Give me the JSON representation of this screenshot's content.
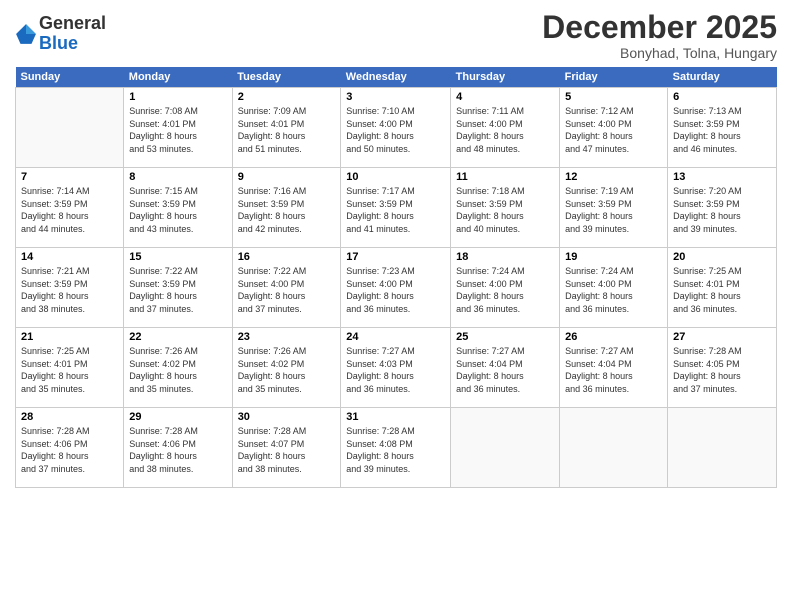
{
  "logo": {
    "general": "General",
    "blue": "Blue"
  },
  "title": "December 2025",
  "location": "Bonyhad, Tolna, Hungary",
  "days_of_week": [
    "Sunday",
    "Monday",
    "Tuesday",
    "Wednesday",
    "Thursday",
    "Friday",
    "Saturday"
  ],
  "weeks": [
    [
      {
        "day": "",
        "info": ""
      },
      {
        "day": "1",
        "info": "Sunrise: 7:08 AM\nSunset: 4:01 PM\nDaylight: 8 hours\nand 53 minutes."
      },
      {
        "day": "2",
        "info": "Sunrise: 7:09 AM\nSunset: 4:01 PM\nDaylight: 8 hours\nand 51 minutes."
      },
      {
        "day": "3",
        "info": "Sunrise: 7:10 AM\nSunset: 4:00 PM\nDaylight: 8 hours\nand 50 minutes."
      },
      {
        "day": "4",
        "info": "Sunrise: 7:11 AM\nSunset: 4:00 PM\nDaylight: 8 hours\nand 48 minutes."
      },
      {
        "day": "5",
        "info": "Sunrise: 7:12 AM\nSunset: 4:00 PM\nDaylight: 8 hours\nand 47 minutes."
      },
      {
        "day": "6",
        "info": "Sunrise: 7:13 AM\nSunset: 3:59 PM\nDaylight: 8 hours\nand 46 minutes."
      }
    ],
    [
      {
        "day": "7",
        "info": "Sunrise: 7:14 AM\nSunset: 3:59 PM\nDaylight: 8 hours\nand 44 minutes."
      },
      {
        "day": "8",
        "info": "Sunrise: 7:15 AM\nSunset: 3:59 PM\nDaylight: 8 hours\nand 43 minutes."
      },
      {
        "day": "9",
        "info": "Sunrise: 7:16 AM\nSunset: 3:59 PM\nDaylight: 8 hours\nand 42 minutes."
      },
      {
        "day": "10",
        "info": "Sunrise: 7:17 AM\nSunset: 3:59 PM\nDaylight: 8 hours\nand 41 minutes."
      },
      {
        "day": "11",
        "info": "Sunrise: 7:18 AM\nSunset: 3:59 PM\nDaylight: 8 hours\nand 40 minutes."
      },
      {
        "day": "12",
        "info": "Sunrise: 7:19 AM\nSunset: 3:59 PM\nDaylight: 8 hours\nand 39 minutes."
      },
      {
        "day": "13",
        "info": "Sunrise: 7:20 AM\nSunset: 3:59 PM\nDaylight: 8 hours\nand 39 minutes."
      }
    ],
    [
      {
        "day": "14",
        "info": "Sunrise: 7:21 AM\nSunset: 3:59 PM\nDaylight: 8 hours\nand 38 minutes."
      },
      {
        "day": "15",
        "info": "Sunrise: 7:22 AM\nSunset: 3:59 PM\nDaylight: 8 hours\nand 37 minutes."
      },
      {
        "day": "16",
        "info": "Sunrise: 7:22 AM\nSunset: 4:00 PM\nDaylight: 8 hours\nand 37 minutes."
      },
      {
        "day": "17",
        "info": "Sunrise: 7:23 AM\nSunset: 4:00 PM\nDaylight: 8 hours\nand 36 minutes."
      },
      {
        "day": "18",
        "info": "Sunrise: 7:24 AM\nSunset: 4:00 PM\nDaylight: 8 hours\nand 36 minutes."
      },
      {
        "day": "19",
        "info": "Sunrise: 7:24 AM\nSunset: 4:00 PM\nDaylight: 8 hours\nand 36 minutes."
      },
      {
        "day": "20",
        "info": "Sunrise: 7:25 AM\nSunset: 4:01 PM\nDaylight: 8 hours\nand 36 minutes."
      }
    ],
    [
      {
        "day": "21",
        "info": "Sunrise: 7:25 AM\nSunset: 4:01 PM\nDaylight: 8 hours\nand 35 minutes."
      },
      {
        "day": "22",
        "info": "Sunrise: 7:26 AM\nSunset: 4:02 PM\nDaylight: 8 hours\nand 35 minutes."
      },
      {
        "day": "23",
        "info": "Sunrise: 7:26 AM\nSunset: 4:02 PM\nDaylight: 8 hours\nand 35 minutes."
      },
      {
        "day": "24",
        "info": "Sunrise: 7:27 AM\nSunset: 4:03 PM\nDaylight: 8 hours\nand 36 minutes."
      },
      {
        "day": "25",
        "info": "Sunrise: 7:27 AM\nSunset: 4:04 PM\nDaylight: 8 hours\nand 36 minutes."
      },
      {
        "day": "26",
        "info": "Sunrise: 7:27 AM\nSunset: 4:04 PM\nDaylight: 8 hours\nand 36 minutes."
      },
      {
        "day": "27",
        "info": "Sunrise: 7:28 AM\nSunset: 4:05 PM\nDaylight: 8 hours\nand 37 minutes."
      }
    ],
    [
      {
        "day": "28",
        "info": "Sunrise: 7:28 AM\nSunset: 4:06 PM\nDaylight: 8 hours\nand 37 minutes."
      },
      {
        "day": "29",
        "info": "Sunrise: 7:28 AM\nSunset: 4:06 PM\nDaylight: 8 hours\nand 38 minutes."
      },
      {
        "day": "30",
        "info": "Sunrise: 7:28 AM\nSunset: 4:07 PM\nDaylight: 8 hours\nand 38 minutes."
      },
      {
        "day": "31",
        "info": "Sunrise: 7:28 AM\nSunset: 4:08 PM\nDaylight: 8 hours\nand 39 minutes."
      },
      {
        "day": "",
        "info": ""
      },
      {
        "day": "",
        "info": ""
      },
      {
        "day": "",
        "info": ""
      }
    ]
  ]
}
